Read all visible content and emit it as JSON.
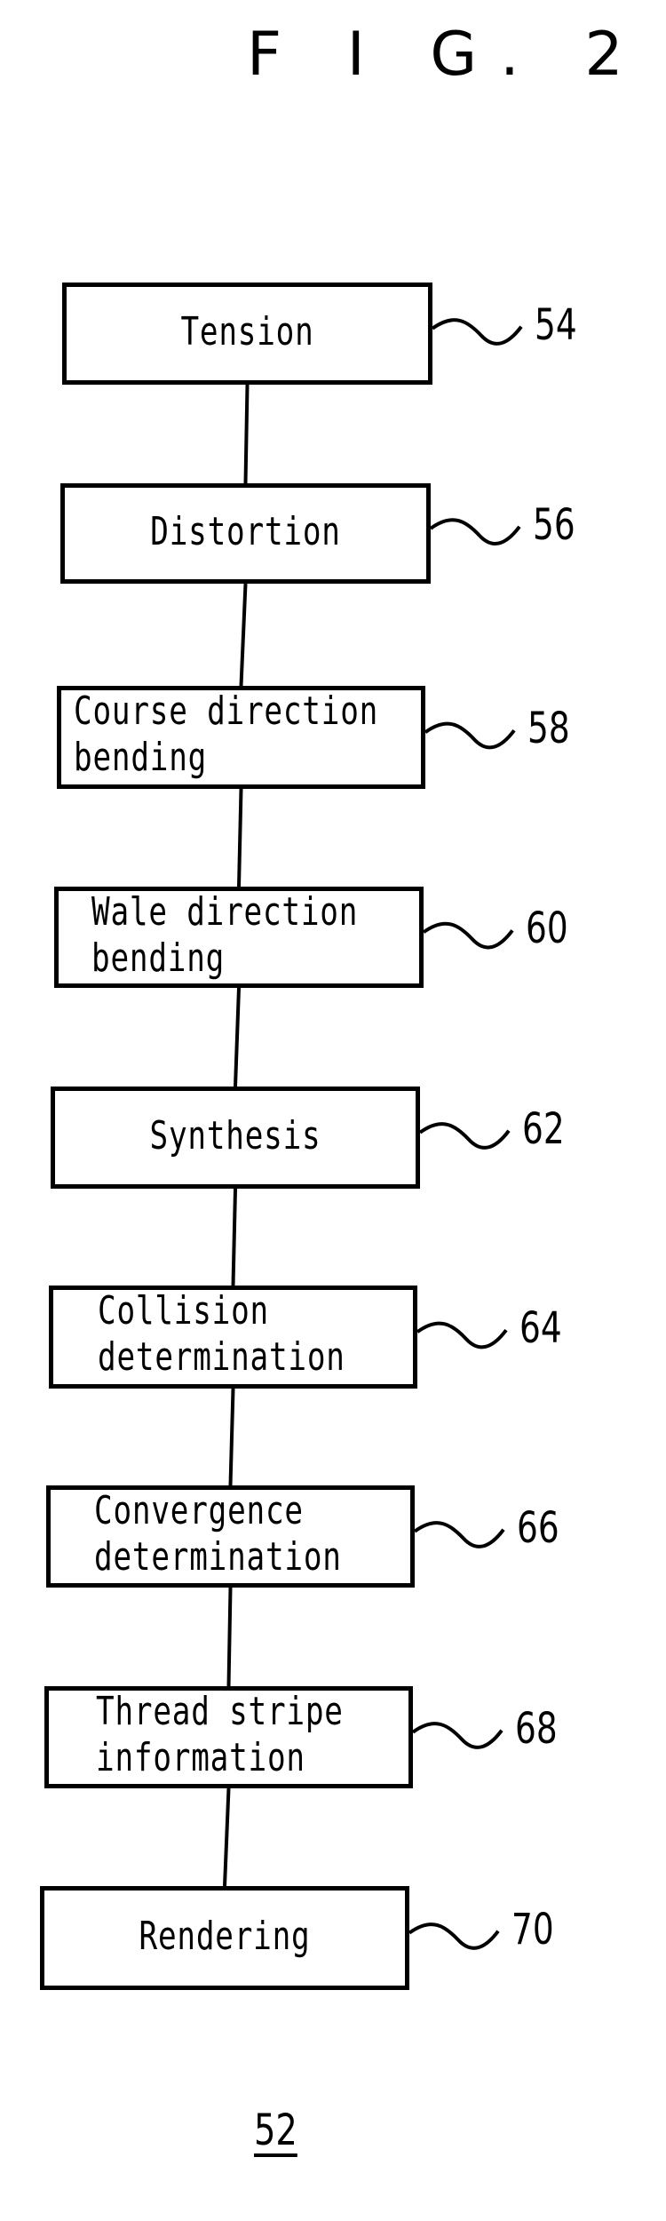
{
  "figure": {
    "title": "F I G. 2",
    "diagram_reference": "52"
  },
  "steps": [
    {
      "lines": [
        "Tension"
      ],
      "ref": "54"
    },
    {
      "lines": [
        "Distortion"
      ],
      "ref": "56"
    },
    {
      "lines": [
        "Course direction",
        "bending"
      ],
      "ref": "58"
    },
    {
      "lines": [
        "Wale direction",
        "bending"
      ],
      "ref": "60"
    },
    {
      "lines": [
        "Synthesis"
      ],
      "ref": "62"
    },
    {
      "lines": [
        "Collision",
        "determination"
      ],
      "ref": "64"
    },
    {
      "lines": [
        "Convergence",
        "determination"
      ],
      "ref": "66"
    },
    {
      "lines": [
        "Thread stripe",
        "information"
      ],
      "ref": "68"
    },
    {
      "lines": [
        "Rendering"
      ],
      "ref": "70"
    }
  ],
  "colors": {
    "ink": "#000000",
    "paper": "#ffffff"
  }
}
